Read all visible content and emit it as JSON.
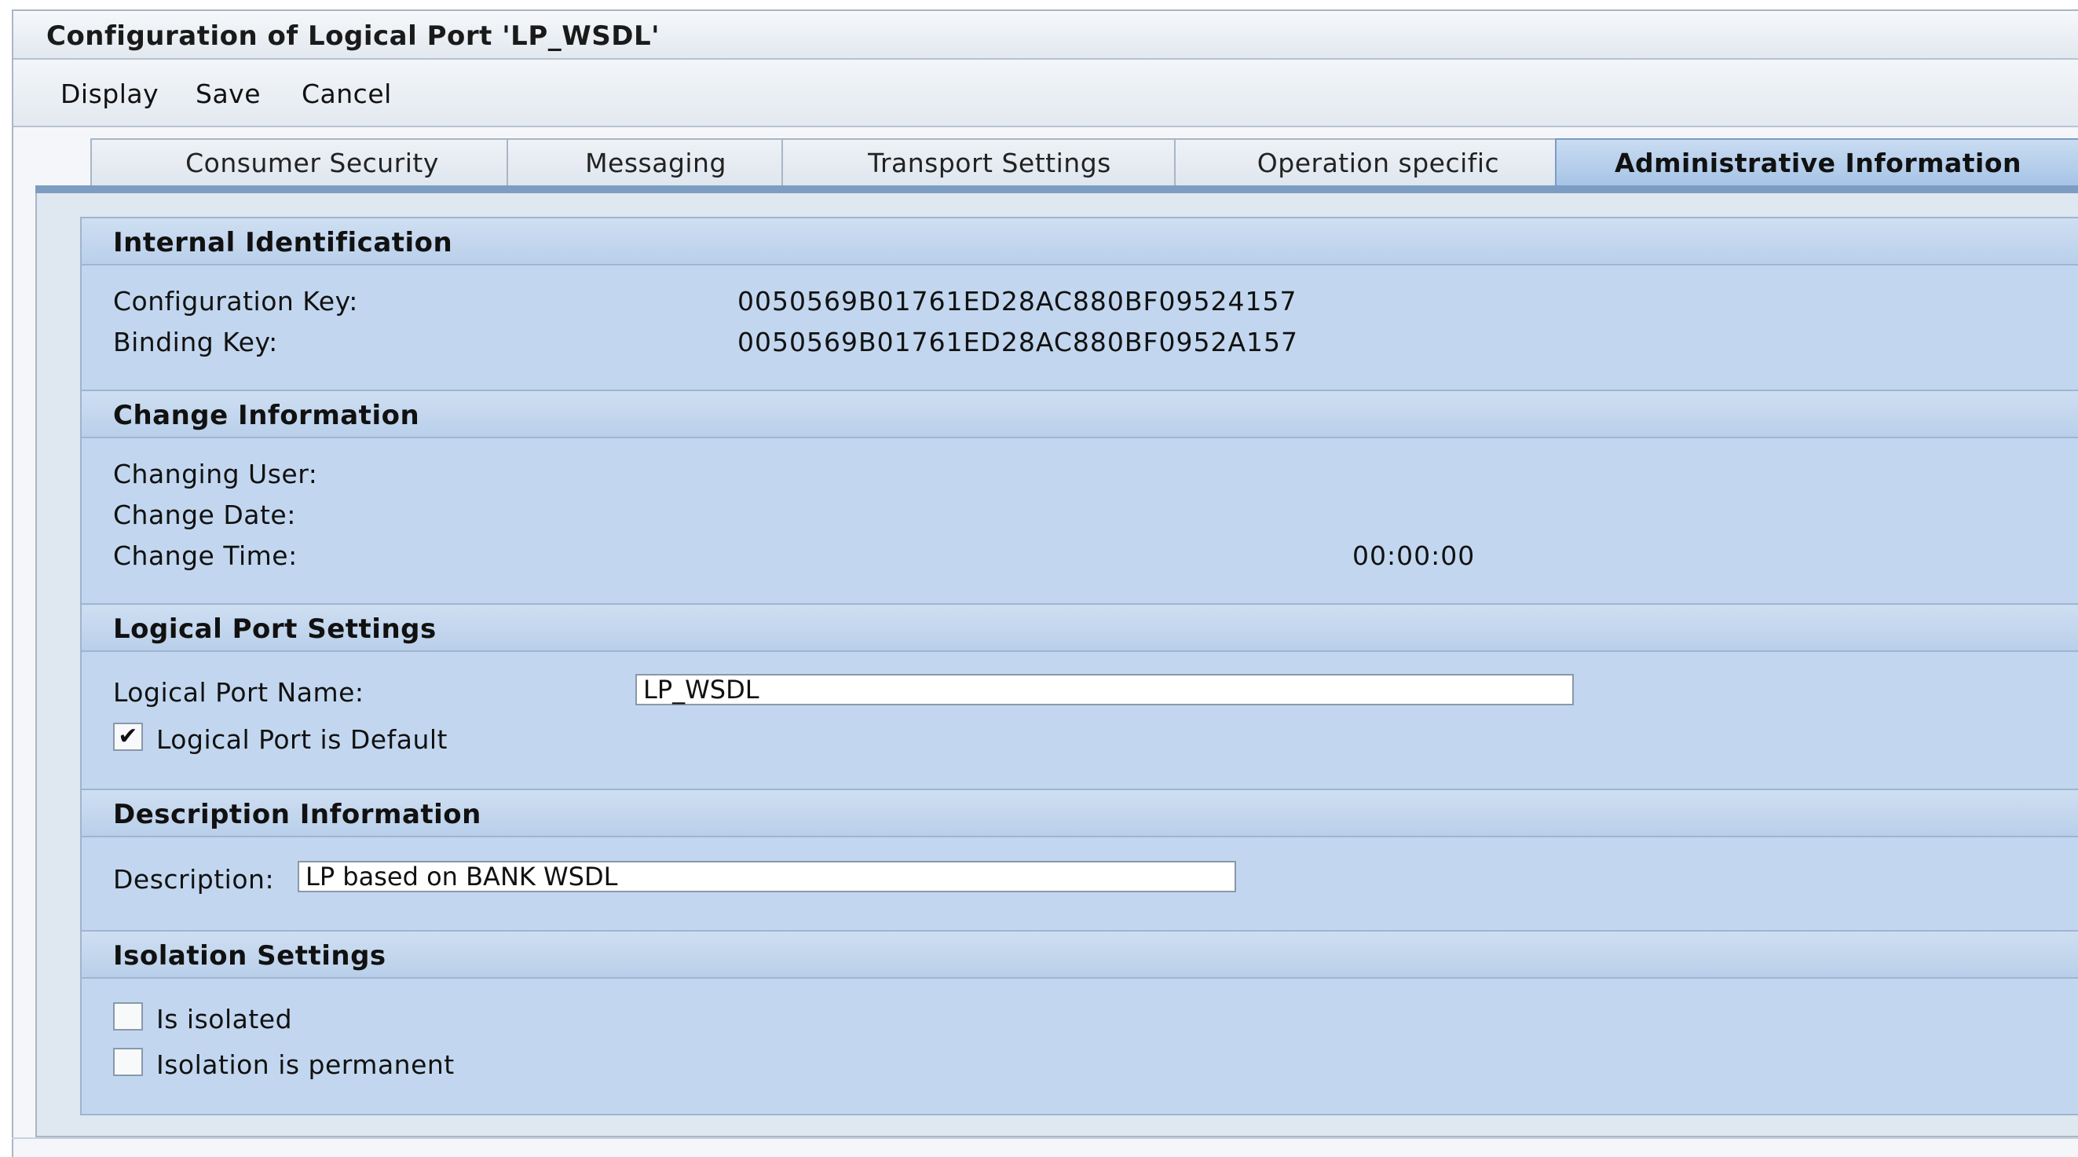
{
  "window": {
    "title": "Configuration of Logical Port 'LP_WSDL'"
  },
  "toolbar": {
    "display": "Display",
    "save": "Save",
    "cancel": "Cancel"
  },
  "tabs": [
    {
      "label": "Consumer Security",
      "active": false
    },
    {
      "label": "Messaging",
      "active": false
    },
    {
      "label": "Transport Settings",
      "active": false
    },
    {
      "label": "Operation specific",
      "active": false
    },
    {
      "label": "Administrative Information",
      "active": true
    }
  ],
  "internal_identification": {
    "title": "Internal Identification",
    "config_key_label": "Configuration Key:",
    "config_key_value": "0050569B01761ED28AC880BF09524157",
    "binding_key_label": "Binding Key:",
    "binding_key_value": "0050569B01761ED28AC880BF0952A157"
  },
  "change_information": {
    "title": "Change Information",
    "user_label": "Changing User:",
    "date_label": "Change Date:",
    "time_label": "Change Time:",
    "time_value": "00:00:00"
  },
  "logical_port_settings": {
    "title": "Logical Port Settings",
    "name_label": "Logical Port Name:",
    "name_value": "LP_WSDL",
    "default_label": "Logical Port is Default",
    "default_checked": true
  },
  "description_information": {
    "title": "Description Information",
    "description_label": "Description:",
    "description_value": "LP based on BANK WSDL"
  },
  "isolation_settings": {
    "title": "Isolation Settings",
    "isolated_label": "Is isolated",
    "isolated_checked": false,
    "permanent_label": "Isolation is permanent",
    "permanent_checked": false
  },
  "colors": {
    "active_tab": "#a7c4e6",
    "group_background": "#c2d7ef",
    "tab_underline": "#7d9cc2"
  }
}
